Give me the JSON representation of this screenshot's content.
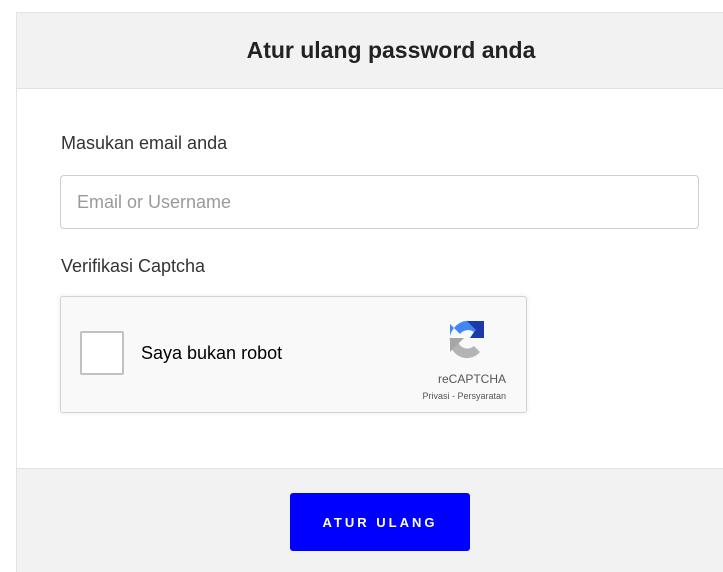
{
  "header": {
    "title": "Atur ulang password anda"
  },
  "form": {
    "email_label": "Masukan email anda",
    "email_placeholder": "Email or Username",
    "email_value": "",
    "captcha_label": "Verifikasi Captcha"
  },
  "recaptcha": {
    "checkbox_label": "Saya bukan robot",
    "checked": false,
    "brand": "reCAPTCHA",
    "privacy": "Privasi",
    "separator": " - ",
    "terms": "Persyaratan",
    "logo_icon": "recaptcha-logo-icon"
  },
  "footer": {
    "submit_label": "ATUR ULANG"
  },
  "colors": {
    "accent": "#0000ff",
    "header_bg": "#f2f2f2",
    "recaptcha_blue": "#1c3aa9",
    "recaptcha_light_blue": "#4285f4",
    "recaptcha_gray": "#b4b4b4"
  }
}
